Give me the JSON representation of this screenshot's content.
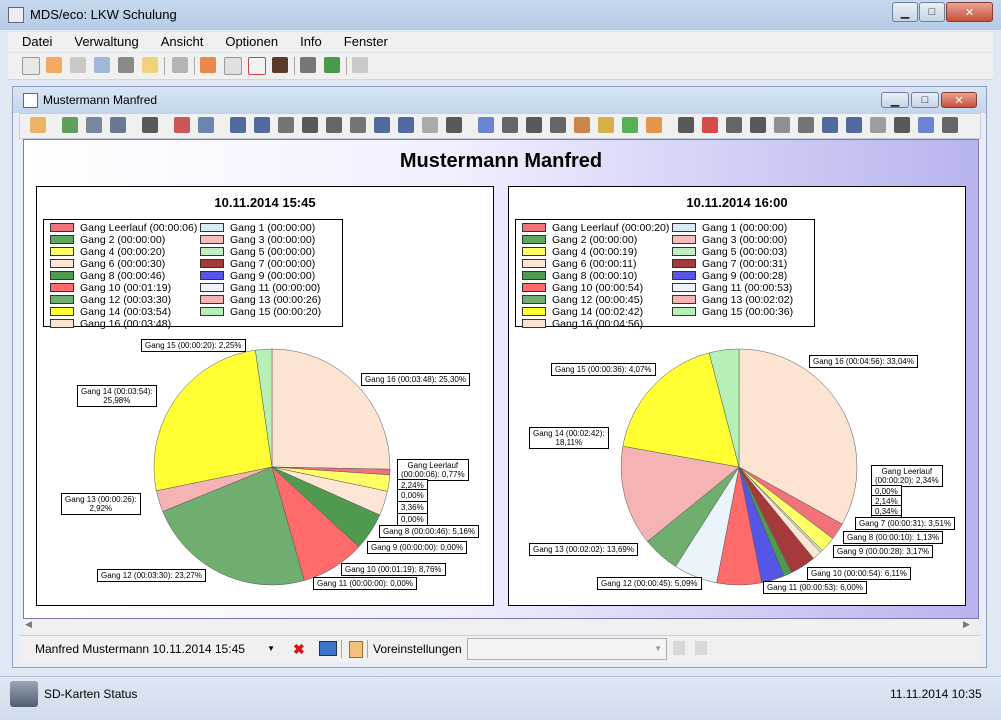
{
  "window": {
    "title": "MDS/eco: LKW Schulung"
  },
  "menu": [
    "Datei",
    "Verwaltung",
    "Ansicht",
    "Optionen",
    "Info",
    "Fenster"
  ],
  "child_window": {
    "title": "Mustermann Manfred"
  },
  "chart_title": "Mustermann Manfred",
  "colors": {
    "leerlauf": "#f2727a",
    "g1": "#d9ecf5",
    "g2": "#5da85d",
    "g3": "#f7bcbc",
    "g4": "#ffff66",
    "g5": "#c2ecc2",
    "g6": "#fde6d6",
    "g7": "#a63a3a",
    "g8": "#4f9a4f",
    "g9": "#5555e6",
    "g10": "#ff6b6b",
    "g11": "#eaf4fa",
    "g12": "#6fae6f",
    "g13": "#f5b3b3",
    "g14": "#ffff33",
    "g15": "#b6f0b6",
    "g16": "#fde3d2"
  },
  "chart_data": [
    {
      "type": "pie",
      "title": "10.11.2014 15:45",
      "legend": [
        "Gang Leerlauf (00:00:06)",
        "Gang 1 (00:00:00)",
        "Gang 2 (00:00:00)",
        "Gang 3 (00:00:00)",
        "Gang 4 (00:00:20)",
        "Gang 5 (00:00:00)",
        "Gang 6 (00:00:30)",
        "Gang 7 (00:00:00)",
        "Gang 8 (00:00:46)",
        "Gang 9 (00:00:00)",
        "Gang 10 (00:01:19)",
        "Gang 11 (00:00:00)",
        "Gang 12 (00:03:30)",
        "Gang 13 (00:00:26)",
        "Gang 14 (00:03:54)",
        "Gang 15 (00:00:20)",
        "Gang 16 (00:03:48)"
      ],
      "slices": [
        {
          "key": "g16",
          "name": "Gang 16",
          "value": 25.3
        },
        {
          "key": "leerlauf",
          "name": "Gang Leerlauf",
          "value": 0.77
        },
        {
          "key": "g1",
          "name": "Gang 1",
          "value": 0.0
        },
        {
          "key": "g2",
          "name": "Gang 2",
          "value": 0.0
        },
        {
          "key": "g3",
          "name": "Gang 3",
          "value": 0.0
        },
        {
          "key": "g4",
          "name": "Gang 4",
          "value": 2.24
        },
        {
          "key": "g5",
          "name": "Gang 5",
          "value": 0.0
        },
        {
          "key": "g6",
          "name": "Gang 6",
          "value": 3.36
        },
        {
          "key": "g7",
          "name": "Gang 7",
          "value": 0.0
        },
        {
          "key": "g8",
          "name": "Gang 8",
          "value": 5.16
        },
        {
          "key": "g9",
          "name": "Gang 9",
          "value": 0.0
        },
        {
          "key": "g10",
          "name": "Gang 10",
          "value": 8.76
        },
        {
          "key": "g11",
          "name": "Gang 11",
          "value": 0.0
        },
        {
          "key": "g12",
          "name": "Gang 12",
          "value": 23.27
        },
        {
          "key": "g13",
          "name": "Gang 13",
          "value": 2.92
        },
        {
          "key": "g14",
          "name": "Gang 14",
          "value": 25.98
        },
        {
          "key": "g15",
          "name": "Gang 15",
          "value": 2.25
        }
      ],
      "labels": [
        "Gang 15 (00:00:20): 2,25%",
        "Gang 16 (00:03:48): 25,30%",
        "Gang 14 (00:03:54):",
        "25,98%",
        "Gang Leerlauf",
        "(00:00:06): 0,77%",
        "2,24%",
        "0,00%",
        "3,36%",
        "0,00%",
        "Gang 8 (00:00:46): 5,16%",
        "Gang 9 (00:00:00): 0,00%",
        "Gang 10 (00:01:19): 8,76%",
        "Gang 11 (00:00:00): 0,00%",
        "Gang 12 (00:03:30): 23,27%",
        "Gang 13 (00:00:26):",
        "2,92%"
      ]
    },
    {
      "type": "pie",
      "title": "10.11.2014 16:00",
      "legend": [
        "Gang Leerlauf (00:00:20)",
        "Gang 1 (00:00:00)",
        "Gang 2 (00:00:00)",
        "Gang 3 (00:00:00)",
        "Gang 4 (00:00:19)",
        "Gang 5 (00:00:03)",
        "Gang 6 (00:00:11)",
        "Gang 7 (00:00:31)",
        "Gang 8 (00:00:10)",
        "Gang 9 (00:00:28)",
        "Gang 10 (00:00:54)",
        "Gang 11 (00:00:53)",
        "Gang 12 (00:00:45)",
        "Gang 13 (00:02:02)",
        "Gang 14 (00:02:42)",
        "Gang 15 (00:00:36)",
        "Gang 16 (00:04:56)"
      ],
      "slices": [
        {
          "key": "g16",
          "name": "Gang 16",
          "value": 33.04
        },
        {
          "key": "leerlauf",
          "name": "Gang Leerlauf",
          "value": 2.34
        },
        {
          "key": "g1",
          "name": "Gang 1",
          "value": 0.0
        },
        {
          "key": "g2",
          "name": "Gang 2",
          "value": 0.0
        },
        {
          "key": "g3",
          "name": "Gang 3",
          "value": 0.0
        },
        {
          "key": "g4",
          "name": "Gang 4",
          "value": 2.14
        },
        {
          "key": "g5",
          "name": "Gang 5",
          "value": 0.34
        },
        {
          "key": "g6",
          "name": "Gang 6",
          "value": 1.26
        },
        {
          "key": "g7",
          "name": "Gang 7",
          "value": 3.51
        },
        {
          "key": "g8",
          "name": "Gang 8",
          "value": 1.13
        },
        {
          "key": "g9",
          "name": "Gang 9",
          "value": 3.17
        },
        {
          "key": "g10",
          "name": "Gang 10",
          "value": 6.11
        },
        {
          "key": "g11",
          "name": "Gang 11",
          "value": 6.0
        },
        {
          "key": "g12",
          "name": "Gang 12",
          "value": 5.09
        },
        {
          "key": "g13",
          "name": "Gang 13",
          "value": 13.69
        },
        {
          "key": "g14",
          "name": "Gang 14",
          "value": 18.11
        },
        {
          "key": "g15",
          "name": "Gang 15",
          "value": 4.07
        }
      ],
      "labels": [
        "Gang 16 (00:04:56): 33,04%",
        "Gang 15 (00:00:36): 4,07%",
        "Gang 14 (00:02:42):",
        "18,11%",
        "Gang Leerlauf",
        "(00:00:20): 2,34%",
        "0,00%",
        "2,14%",
        "0,34%",
        "1,26%",
        "Gang 7 (00:00:31): 3,51%",
        "Gang 8 (00:00:10): 1,13%",
        "Gang 9 (00:00:28): 3,17%",
        "Gang 10 (00:00:54): 6,11%",
        "Gang 11 (00:00:53): 6,00%",
        "Gang 12 (00:00:45): 5,09%",
        "Gang 13 (00:02:02): 13,69%"
      ]
    }
  ],
  "bottom": {
    "selection": "Manfred Mustermann 10.11.2014 15:45",
    "presets_label": "Voreinstellungen",
    "presets_value": ""
  },
  "status": {
    "text": "SD-Karten Status",
    "datetime": "11.11.2014 10:35"
  }
}
